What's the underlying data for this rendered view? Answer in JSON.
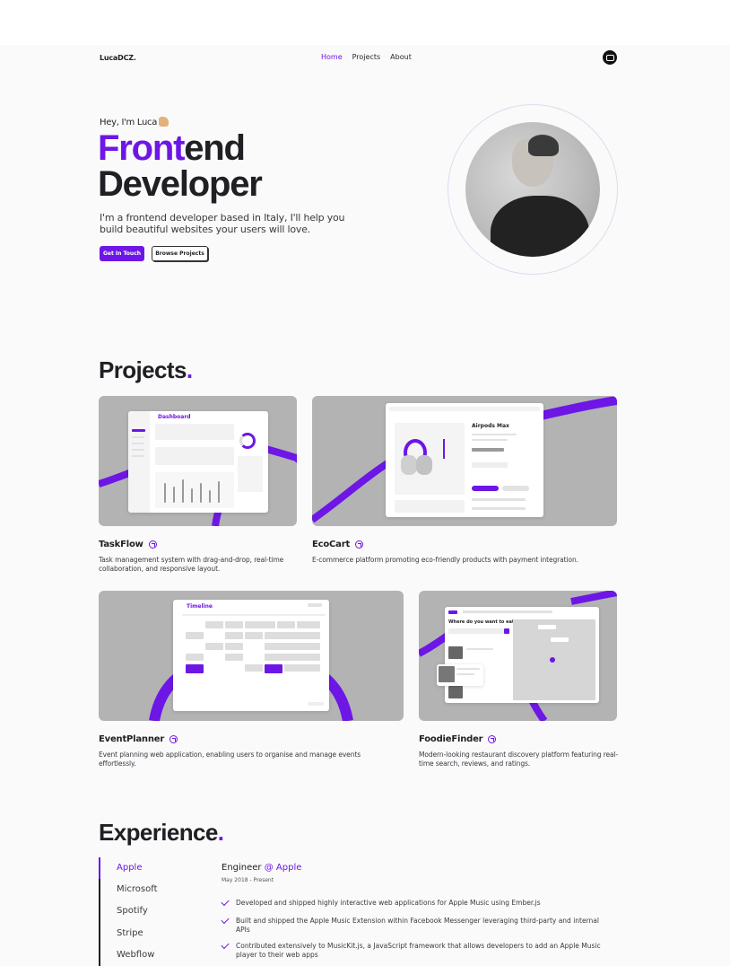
{
  "nav": {
    "logo": "LucaDCZ.",
    "links": [
      "Home",
      "Projects",
      "About"
    ]
  },
  "hero": {
    "greeting": "Hey, I'm Luca",
    "title_accent": "Front",
    "title_rest": "end",
    "title_line2": "Developer",
    "intro": "I'm a frontend developer based in Italy, I'll help you build beautiful websites your users will love.",
    "cta_primary": "Get In Touch",
    "cta_secondary": "Browse Projects"
  },
  "projects": {
    "heading": "Projects",
    "items": [
      {
        "name": "TaskFlow",
        "description": "Task management system with drag-and-drop, real-time collaboration, and responsive layout.",
        "mock_title": "Dashboard"
      },
      {
        "name": "EcoCart",
        "description": "E-commerce platform promoting eco-friendly products with payment integration.",
        "mock_title": "Airpods Max"
      },
      {
        "name": "EventPlanner",
        "description": "Event planning web application, enabling users to organise and manage events effortlessly.",
        "mock_title": "Timeline"
      },
      {
        "name": "FoodieFinder",
        "description": "Modern-looking restaurant discovery platform featuring real-time search, reviews, and ratings.",
        "mock_title": "Where do you want to eat?"
      }
    ]
  },
  "experience": {
    "heading": "Experience",
    "companies": [
      "Apple",
      "Microsoft",
      "Spotify",
      "Stripe",
      "Webflow"
    ],
    "active_role": "Engineer",
    "active_company": "@ Apple",
    "dates": "May 2018 - Present",
    "bullets": [
      "Developed and shipped highly interactive web applications for Apple Music using Ember.js",
      "Built and shipped the Apple Music Extension within Facebook Messenger leveraging third-party and internal APIs",
      "Contributed extensively to MusicKit.js, a JavaScript framework that allows developers to add an Apple Music player to their web apps"
    ]
  },
  "colors": {
    "accent": "#6d16e6",
    "card_bg": "#b3b3b3",
    "text": "#1f1f24"
  }
}
